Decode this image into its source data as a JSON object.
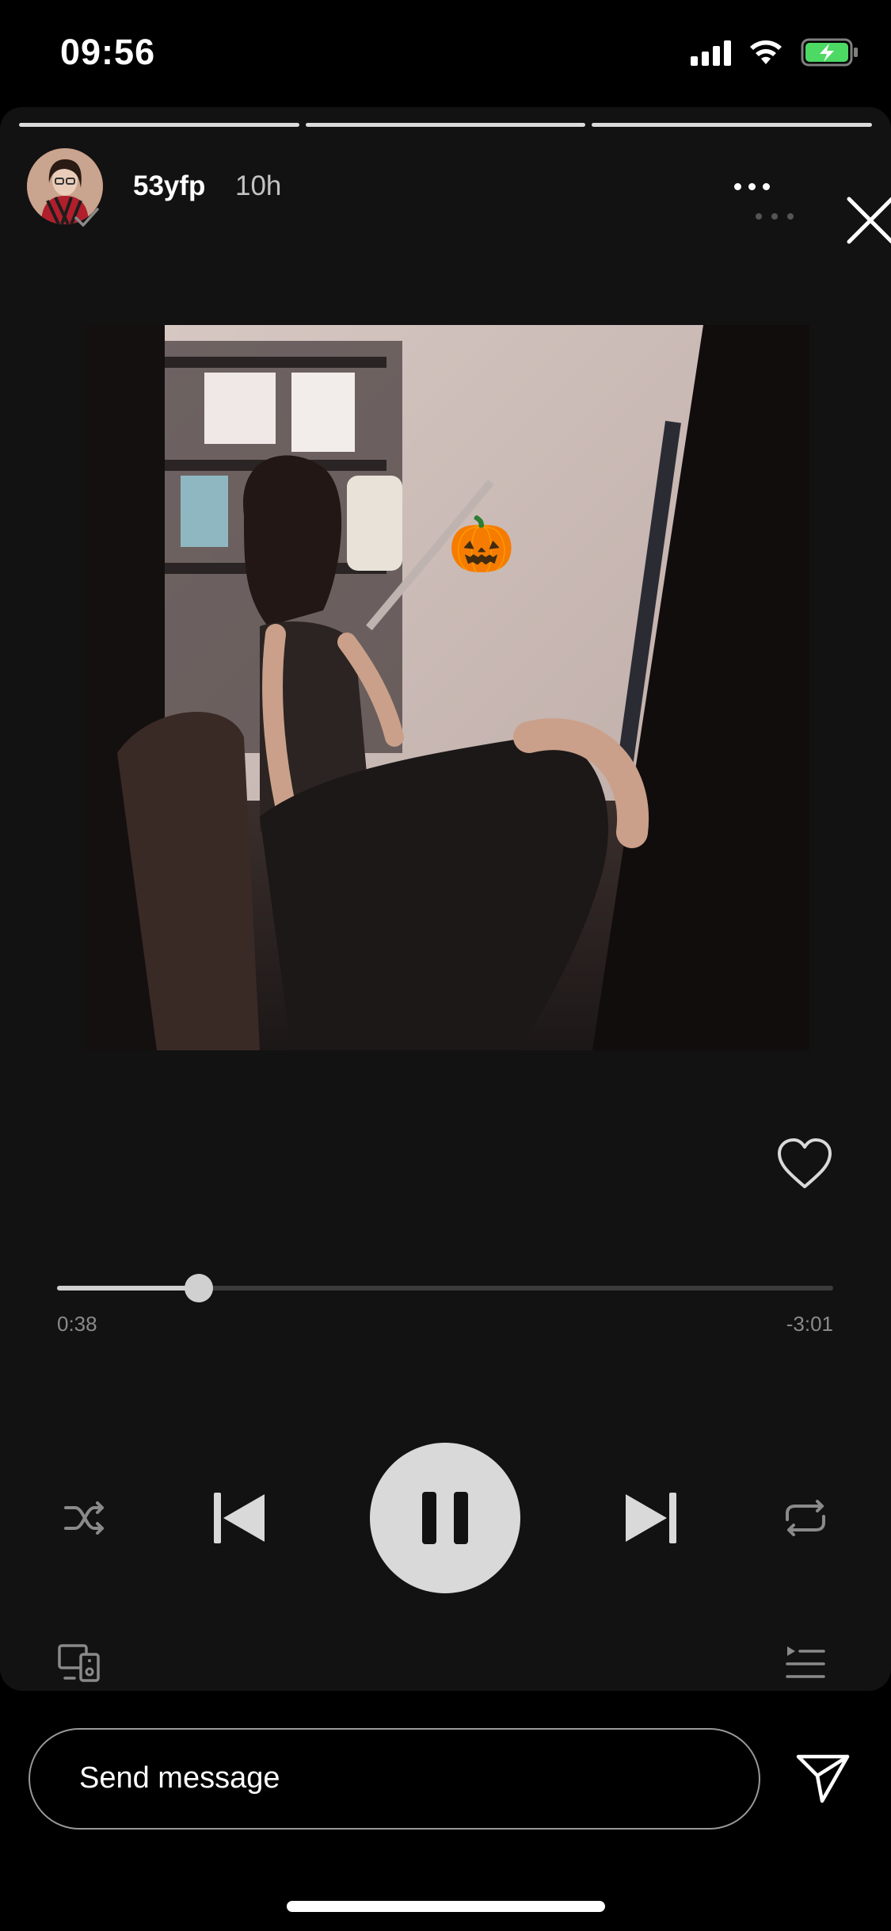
{
  "status_bar": {
    "time": "09:56",
    "icons": [
      "cellular-signal-icon",
      "wifi-icon",
      "battery-charging-icon"
    ],
    "battery_color": "#4cd964"
  },
  "story": {
    "progress_segments": 3,
    "username": "53yfp",
    "timestamp": "10h",
    "icons": [
      "avatar",
      "more-icon",
      "close-icon"
    ]
  },
  "player": {
    "album_art": {
      "description_icon": "album-art-image",
      "sticker": "🎃"
    },
    "progress_fraction": 0.183,
    "elapsed": "0:38",
    "remaining": "-3:01",
    "controls": [
      "shuffle-icon",
      "previous-icon",
      "pause-icon",
      "next-icon",
      "repeat-icon"
    ],
    "extras": [
      "heart-icon",
      "devices-icon",
      "queue-icon"
    ],
    "accent_color": "#d9d9d9"
  },
  "message_bar": {
    "placeholder": "Send message",
    "send_icon": "send-icon"
  }
}
